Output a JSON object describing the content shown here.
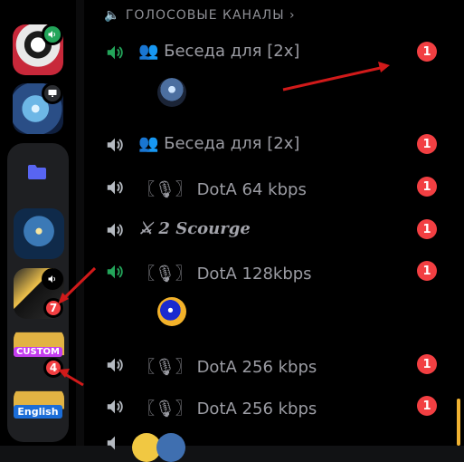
{
  "rail": {
    "folder_badges": [
      "7",
      "4"
    ],
    "custom_label": "CUSTOM",
    "english_label": "English"
  },
  "channels": {
    "category": "ГОЛОСОВЫЕ КАНАЛЫ",
    "chevron": "›",
    "items": [
      {
        "name": "👥 Беседа для [2x]",
        "unread": "1",
        "active": true
      },
      {
        "name": "👥 Беседа для [2x]",
        "unread": "1",
        "active": false
      },
      {
        "name": "〖🎙〗 DotA 64 kbps",
        "unread": "1",
        "active": false
      },
      {
        "name": "⚔ 2 Scourge",
        "unread": "1",
        "active": false
      },
      {
        "name": "〖🎙〗 DotA 128kbps",
        "unread": "1",
        "active": true
      },
      {
        "name": "〖🎙〗 DotA 256 kbps",
        "unread": "1",
        "active": false
      },
      {
        "name": "〖🎙〗 DotA 256 kbps",
        "unread": "1",
        "active": false
      }
    ]
  },
  "colors": {
    "active_speaker": "#23a55a",
    "idle_speaker": "#b5bac1",
    "unread_badge": "#f23f42",
    "annotation_arrow": "#d11a1a"
  }
}
